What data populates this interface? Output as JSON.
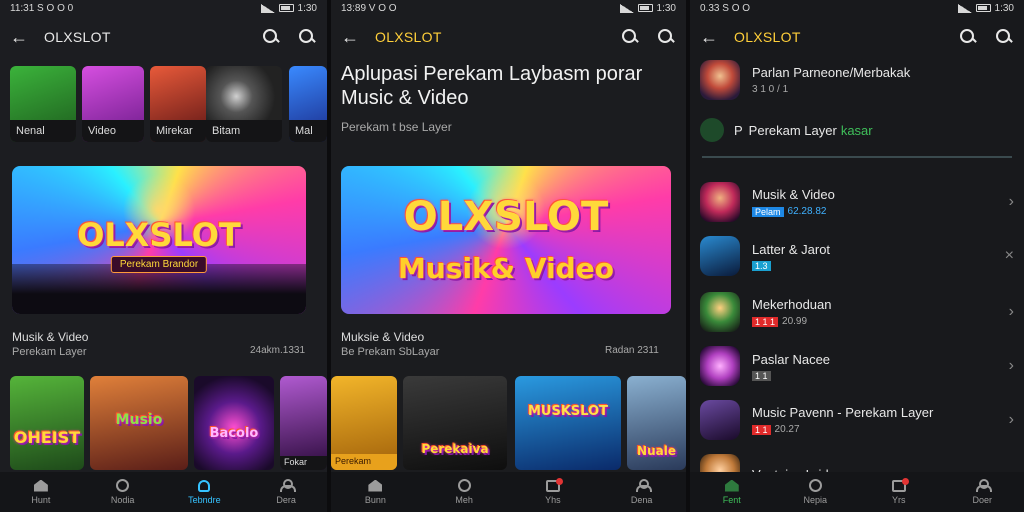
{
  "screen1": {
    "status": {
      "time": "11:31 S O O 0"
    },
    "status_right": "1:30",
    "title": "OLXSLOT",
    "top_tiles": [
      {
        "label": "Nenal",
        "color": "#2e8d2e"
      },
      {
        "label": "Video",
        "color": "#b634c4"
      },
      {
        "label": "Mirekar",
        "color": "#c23a3a"
      },
      {
        "label": "Bitam",
        "color": "#3a3a3a"
      },
      {
        "label": "Mal",
        "color": "#2a58d0"
      }
    ],
    "banner": {
      "logo": "OLXSLOT",
      "subtitle": "Perekam Brandor"
    },
    "info": {
      "title": "Musik & Video",
      "subtitle": "Perekam Layer",
      "time": "24akm.1331"
    },
    "bottom_tiles": [
      {
        "label": "OHEIST",
        "color": "#3f8a2e"
      },
      {
        "label": "Musio",
        "color": "#b8562a"
      },
      {
        "label": "Bacolo",
        "color": "#8a1c88"
      },
      {
        "label": "Fokar",
        "color": "#5a2a5a"
      }
    ],
    "nav": [
      {
        "label": "Hunt",
        "icon": "home-icon"
      },
      {
        "label": "Nodia",
        "icon": "disc-icon"
      },
      {
        "label": "Tebndre",
        "icon": "bell-icon"
      },
      {
        "label": "Dera",
        "icon": "user-icon"
      }
    ]
  },
  "screen2": {
    "status": {
      "time": "13:89 V O O"
    },
    "status_right": "1:30",
    "title": "OLXSLOT",
    "headline": "Aplupasi Perekam Laybasm porar Music & Video",
    "headline_sub": "Perekam t bse Layer",
    "banner": {
      "logo_line1": "OLXSLOT",
      "logo_line2": "Musik& Video"
    },
    "info": {
      "title": "Muksie & Video",
      "subtitle": "Be Prekam SbLayar",
      "time": "Radan 2311"
    },
    "tiles": [
      {
        "label": "Perekam",
        "color": "#e8a11c"
      },
      {
        "label": "Perekaiva",
        "color": "#2a2a2a"
      },
      {
        "label": "MUSKSLOT",
        "color": "#2a7ad0"
      },
      {
        "label": "Nuale",
        "color": "#6a8ab0"
      }
    ],
    "nav": [
      {
        "label": "Bunn",
        "icon": "home-icon"
      },
      {
        "label": "Meh",
        "icon": "disc-icon"
      },
      {
        "label": "Yhs",
        "icon": "box-icon"
      },
      {
        "label": "Dena",
        "icon": "user-icon"
      }
    ]
  },
  "screen3": {
    "status": {
      "time": "0.33 S O O"
    },
    "status_right": "1:30",
    "title": "OLXSLOT",
    "top_item": {
      "title": "Parlan Parneone/Merbakak",
      "sub": "3 1 0 / 1"
    },
    "green_item": {
      "prefix": "P",
      "text": "Perekam Layer",
      "suffix": "kasar"
    },
    "list": [
      {
        "title": "Musik & Video",
        "tag": "Pelam",
        "meta": "62.28.82",
        "tag_color": "#1e88e5",
        "meta_color": "#3fb1ff",
        "action": "›"
      },
      {
        "title": "Latter & Jarot",
        "tag": "1.3",
        "meta": "",
        "tag_color": "#1aa0d0",
        "meta_color": "#aaa",
        "action": "×"
      },
      {
        "title": "Mekerhoduan",
        "tag": "1 1 1",
        "meta": "20.99",
        "tag_color": "#e02a2a",
        "meta_color": "#aaa",
        "action": "›"
      },
      {
        "title": "Paslar Nacee",
        "tag": "1 1",
        "meta": "",
        "tag_color": "#555",
        "meta_color": "#aaa",
        "action": "›"
      },
      {
        "title": "Music Pavenn - Perekam Layer",
        "tag": "1 1",
        "meta": "20.27",
        "tag_color": "#e02a2a",
        "meta_color": "#aaa",
        "action": "›"
      },
      {
        "title": "Ventains Iwider",
        "tag": "",
        "meta": "",
        "tag_color": "#555",
        "meta_color": "#aaa",
        "action": ""
      }
    ],
    "nav": [
      {
        "label": "Fent",
        "icon": "home-icon"
      },
      {
        "label": "Nepia",
        "icon": "disc-icon"
      },
      {
        "label": "Yrs",
        "icon": "box-icon"
      },
      {
        "label": "Doer",
        "icon": "user-icon"
      }
    ]
  }
}
